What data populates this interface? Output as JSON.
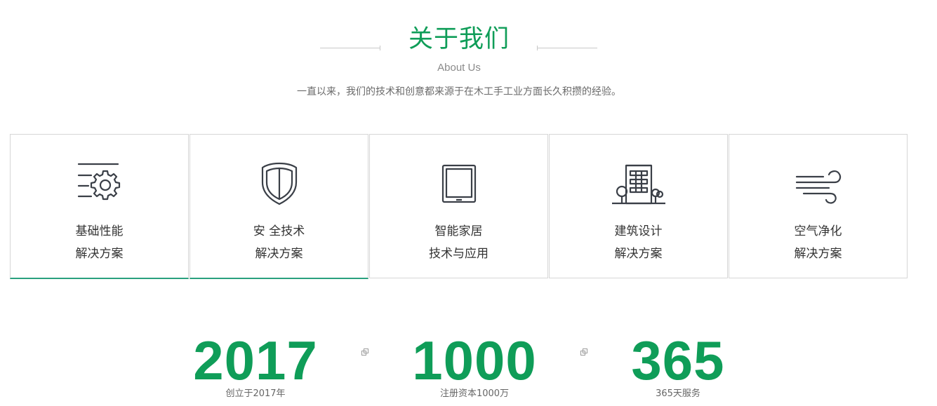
{
  "header": {
    "title": "关于我们",
    "subtitle": "About Us",
    "description": "一直以来，我们的技术和创意都来源于在木工手工业方面长久积攒的经验。"
  },
  "colors": {
    "accent": "#0f9d58",
    "active_border": "#2aa07e",
    "icon": "#3a3f47"
  },
  "cards": [
    {
      "icon": "settings-gear-icon",
      "line1": "基础性能",
      "line2": "解决方案"
    },
    {
      "icon": "shield-icon",
      "line1": "安 全技术",
      "line2": "解决方案"
    },
    {
      "icon": "tablet-icon",
      "line1": "智能家居",
      "line2": "技术与应用"
    },
    {
      "icon": "building-icon",
      "line1": "建筑设计",
      "line2": "解决方案"
    },
    {
      "icon": "wind-icon",
      "line1": "空气净化",
      "line2": "解决方案"
    }
  ],
  "stats": [
    {
      "value": "2017",
      "caption": "创立于2017年"
    },
    {
      "value": "1000",
      "caption": "注册资本1000万"
    },
    {
      "value": "365",
      "caption": "365天服务"
    }
  ]
}
